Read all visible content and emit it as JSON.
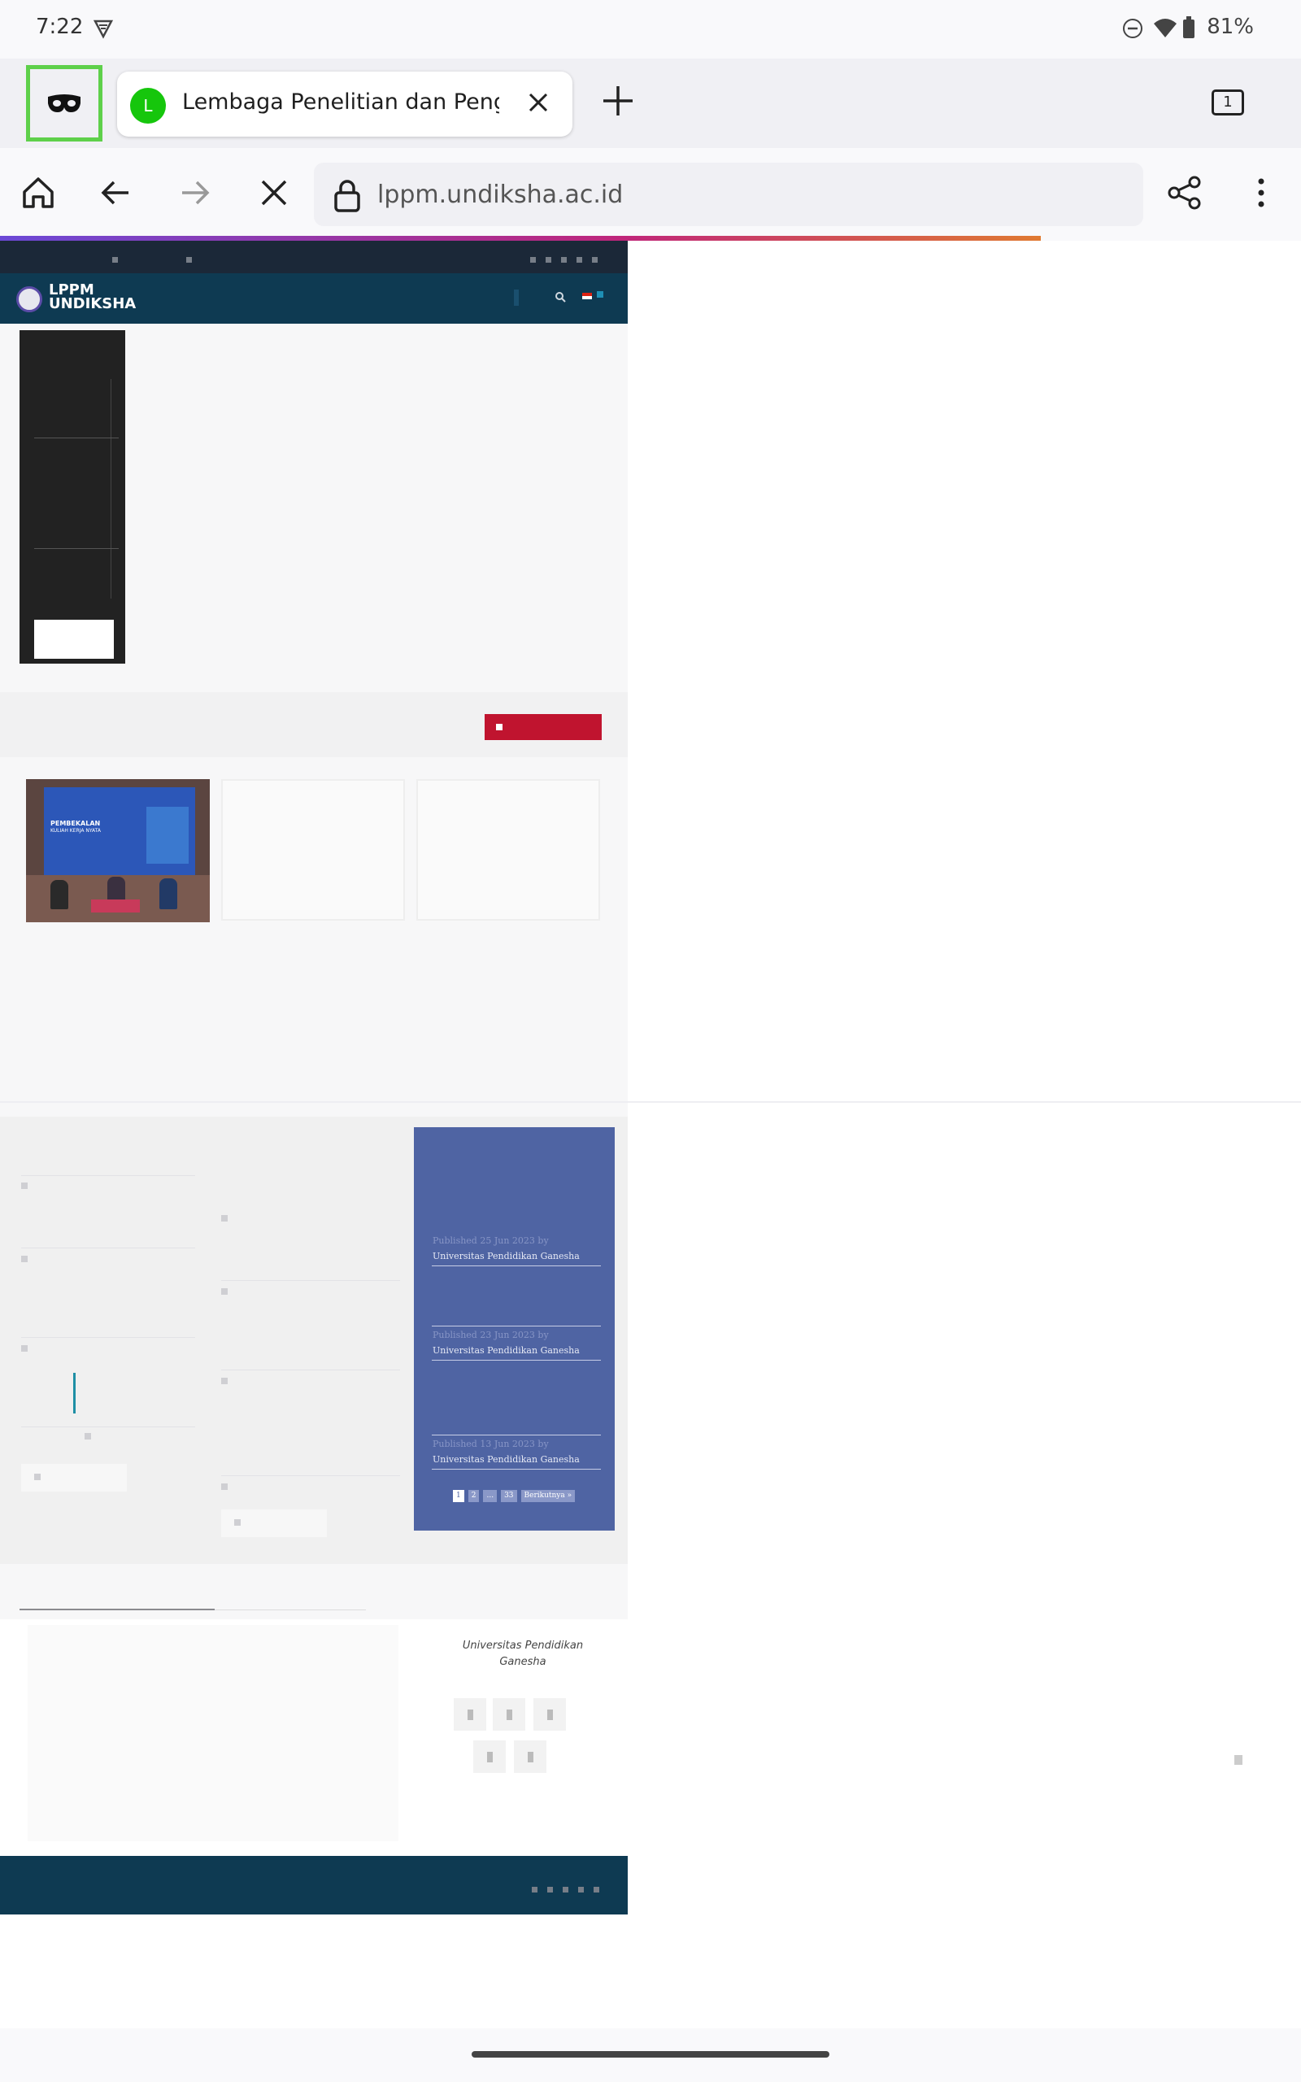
{
  "status_bar": {
    "time": "7:22",
    "battery": "81%",
    "icons": [
      "vpn-shield-icon",
      "dnd-icon",
      "wifi-icon",
      "battery-icon"
    ]
  },
  "tab_strip": {
    "active_tab": {
      "favicon_letter": "L",
      "title": "Lembaga Penelitian dan Peng"
    },
    "tab_count": "1"
  },
  "toolbar": {
    "url": "lppm.undiksha.ac.id"
  },
  "site": {
    "logo_line1": "LPPM",
    "logo_line2": "UNDIKSHA",
    "featured_image_title": "PEMBEKALAN",
    "featured_image_subtitle": "KULIAH KERJA NYATA",
    "posts": [
      {
        "meta_prefix": "Published 25 Jun 2023 by",
        "author": "Universitas Pendidikan Ganesha"
      },
      {
        "meta_prefix": "Published 23 Jun 2023 by",
        "author": "Universitas Pendidikan Ganesha"
      },
      {
        "meta_prefix": "Published 13 Jun 2023 by",
        "author": "Universitas Pendidikan Ganesha"
      }
    ],
    "pagination": [
      "1",
      "2",
      "...",
      "33",
      "Berikutnya »"
    ],
    "footer_org": "Universitas Pendidikan Ganesha"
  },
  "colors": {
    "header_navy": "#0e3a52",
    "accent_red": "#c0142f",
    "sidebar_blue": "#4f64a3",
    "incognito_highlight": "#5ed04a"
  }
}
